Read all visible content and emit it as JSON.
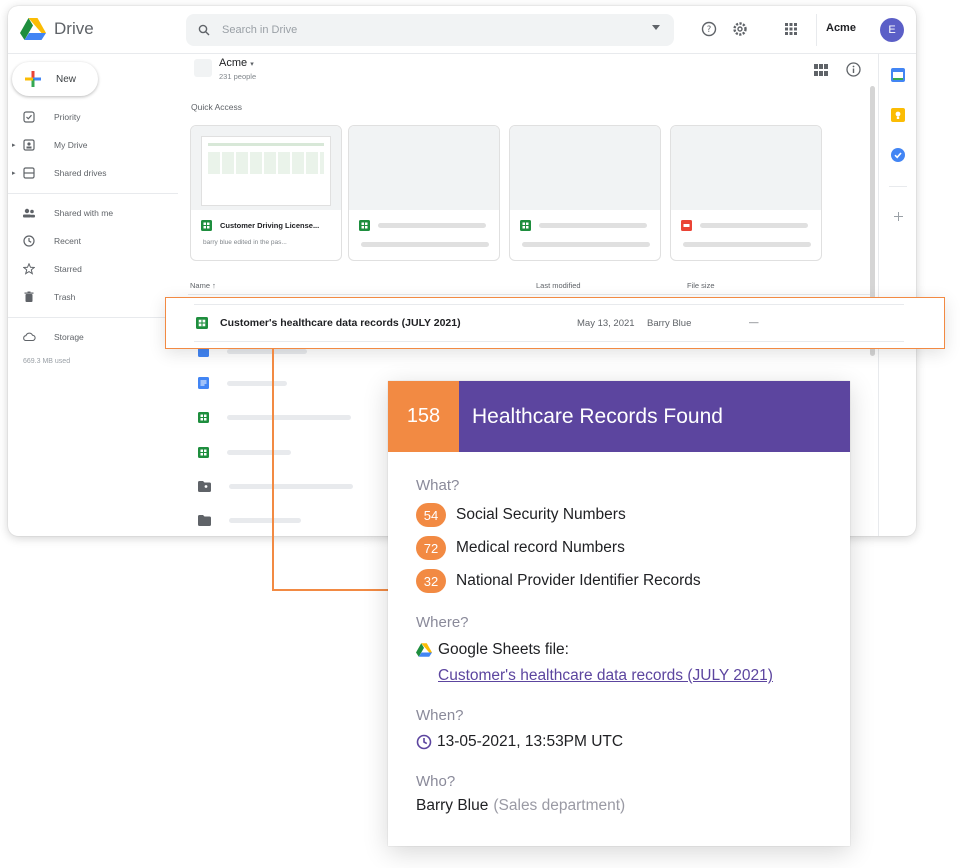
{
  "app": {
    "name": "Drive",
    "search_placeholder": "Search in Drive",
    "org_name": "Acme",
    "avatar_initial": "E"
  },
  "sidebar": {
    "new_label": "New",
    "items": [
      {
        "label": "Priority",
        "icon": "priority-icon"
      },
      {
        "label": "My Drive",
        "icon": "my-drive-icon"
      },
      {
        "label": "Shared drives",
        "icon": "shared-drives-icon"
      },
      {
        "label": "Shared with me",
        "icon": "shared-with-me-icon"
      },
      {
        "label": "Recent",
        "icon": "clock-icon"
      },
      {
        "label": "Starred",
        "icon": "star-icon"
      },
      {
        "label": "Trash",
        "icon": "trash-icon"
      },
      {
        "label": "Storage",
        "icon": "cloud-icon"
      }
    ],
    "storage_used": "669.3 MB used"
  },
  "main": {
    "folder_title": "Acme",
    "folder_subtitle": "231 people",
    "quick_access_label": "Quick Access",
    "quick_cards": [
      {
        "name": "Customer Driving License...",
        "subtitle": "barry blue edited in the pas..."
      }
    ],
    "columns": {
      "name": "Name",
      "last_modified": "Last modified",
      "file_size": "File size"
    }
  },
  "highlight_row": {
    "name": "Customer's healthcare data records (JULY 2021)",
    "date": "May 13, 2021",
    "owner": "Barry Blue",
    "size": "—"
  },
  "detail": {
    "count": "158",
    "title": "Healthcare Records Found",
    "what_label": "What?",
    "findings": [
      {
        "count": "54",
        "label": "Social Security Numbers"
      },
      {
        "count": "72",
        "label": "Medical record Numbers"
      },
      {
        "count": "32",
        "label": "National Provider Identifier Records"
      }
    ],
    "where_label": "Where?",
    "file_type": "Google Sheets file:",
    "file_link": "Customer's healthcare data records (JULY 2021)",
    "when_label": "When?",
    "timestamp": "13-05-2021, 13:53PM UTC",
    "who_label": "Who?",
    "person": "Barry Blue",
    "department": "(Sales department)"
  },
  "colors": {
    "accent_orange": "#f28a43",
    "accent_purple": "#5c459f",
    "sheets_green": "#1e8e3e",
    "docs_blue": "#4285f4"
  }
}
